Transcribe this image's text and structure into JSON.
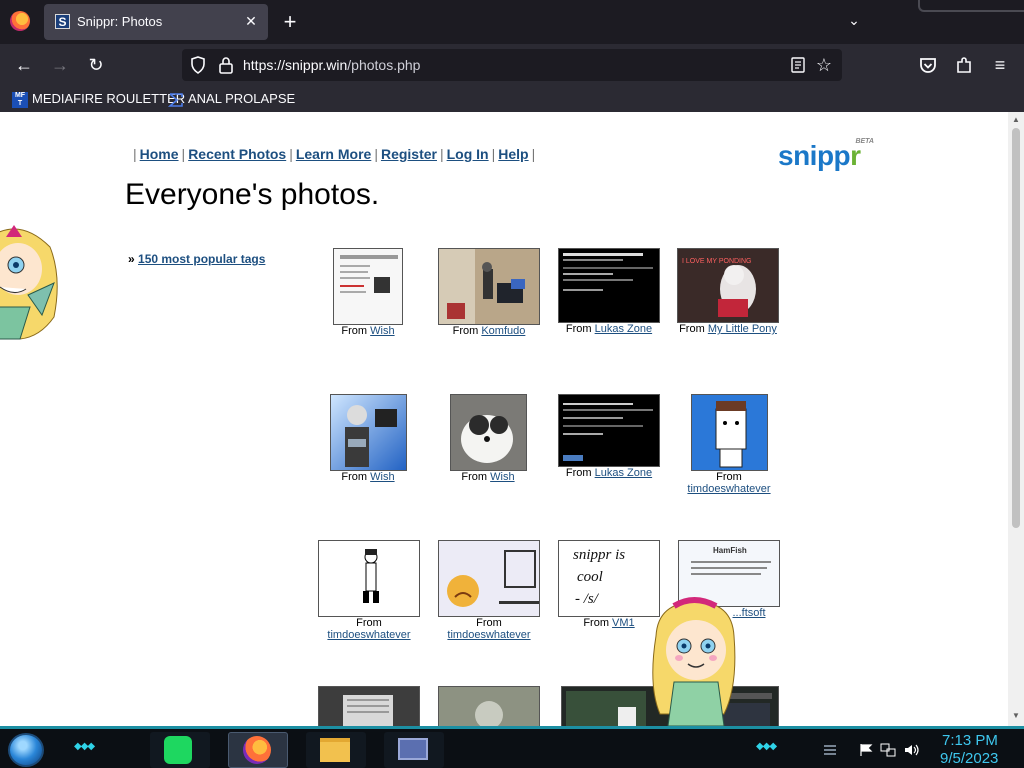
{
  "browser": {
    "tab_title": "Snippr: Photos",
    "tab_favicon_letter": "S",
    "url_host": "https://snippr.win",
    "url_path": "/photos.php",
    "bookmarks": [
      {
        "label": "MEDIAFIRE ROULETTER",
        "icon": "mediafire-icon"
      },
      {
        "label": "ANAL PROLAPSE",
        "icon": "sigma-icon"
      }
    ]
  },
  "site": {
    "nav": [
      "Home",
      "Recent Photos",
      "Learn More",
      "Register",
      "Log In",
      "Help"
    ],
    "logo_text_main": "snipp",
    "logo_text_accent": "r",
    "logo_badge": "BETA",
    "page_title": "Everyone's photos.",
    "tags_prefix": "»",
    "tags_link": "150 most popular tags",
    "from_label": "From",
    "photos": [
      {
        "source": "Wish"
      },
      {
        "source": "Komfudo"
      },
      {
        "source": "Lukas Zone"
      },
      {
        "source": "My Little Pony"
      },
      {
        "source": "Wish"
      },
      {
        "source": "Wish"
      },
      {
        "source": "Lukas Zone"
      },
      {
        "source": "timdoeswhatever"
      },
      {
        "source": "timdoeswhatever"
      },
      {
        "source": "timdoeswhatever"
      },
      {
        "source": "VM1"
      },
      {
        "source": "...ftsoft"
      }
    ],
    "photo_texts": {
      "pony_caption": "I LOVE MY PONDING",
      "handwritten_1": "snippr is",
      "handwritten_2": "cool",
      "handwritten_3": "- /s/",
      "hamfish_logo": "HamFish"
    }
  },
  "taskbar": {
    "time": "7:13 PM",
    "date": "9/5/2023"
  },
  "colors": {
    "link": "#1d4f80",
    "logo_blue": "#1b78c8",
    "logo_green": "#6bb234",
    "clock": "#3ec7ee"
  }
}
